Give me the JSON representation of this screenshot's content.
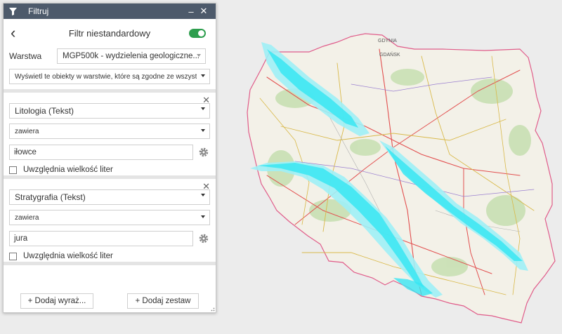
{
  "window": {
    "title": "Filtruj",
    "minimize": "–",
    "close": "✕"
  },
  "header": {
    "title": "Filtr niestandardowy",
    "toggle_on": true
  },
  "layer": {
    "label": "Warstwa",
    "value": "MGP500k - wydzielenia geologiczne..."
  },
  "match_mode": {
    "value": "Wyświetl te obiekty w warstwie, które są zgodne ze wszystkimi"
  },
  "expressions": [
    {
      "field": "Litologia (Tekst)",
      "operator": "zawiera",
      "value": "iłowce",
      "case_label": "Uwzględnia wielkość liter",
      "case_checked": false
    },
    {
      "field": "Stratygrafia (Tekst)",
      "operator": "zawiera",
      "value": "jura",
      "case_label": "Uwzględnia wielkość liter",
      "case_checked": false
    }
  ],
  "footer": {
    "add_expression": "+ Dodaj wyraż...",
    "add_set": "+ Dodaj zestaw"
  },
  "map": {
    "labels": [
      "GDYNIA",
      "GDAŃSK"
    ],
    "colors": {
      "land": "#f3f1e8",
      "highlight": "#38e6f2",
      "highlight_light": "#9ff0f6",
      "border": "#e05c8a",
      "road_major": "#e25050",
      "road_minor": "#d9b94a",
      "forest": "#b8d9a0"
    }
  }
}
